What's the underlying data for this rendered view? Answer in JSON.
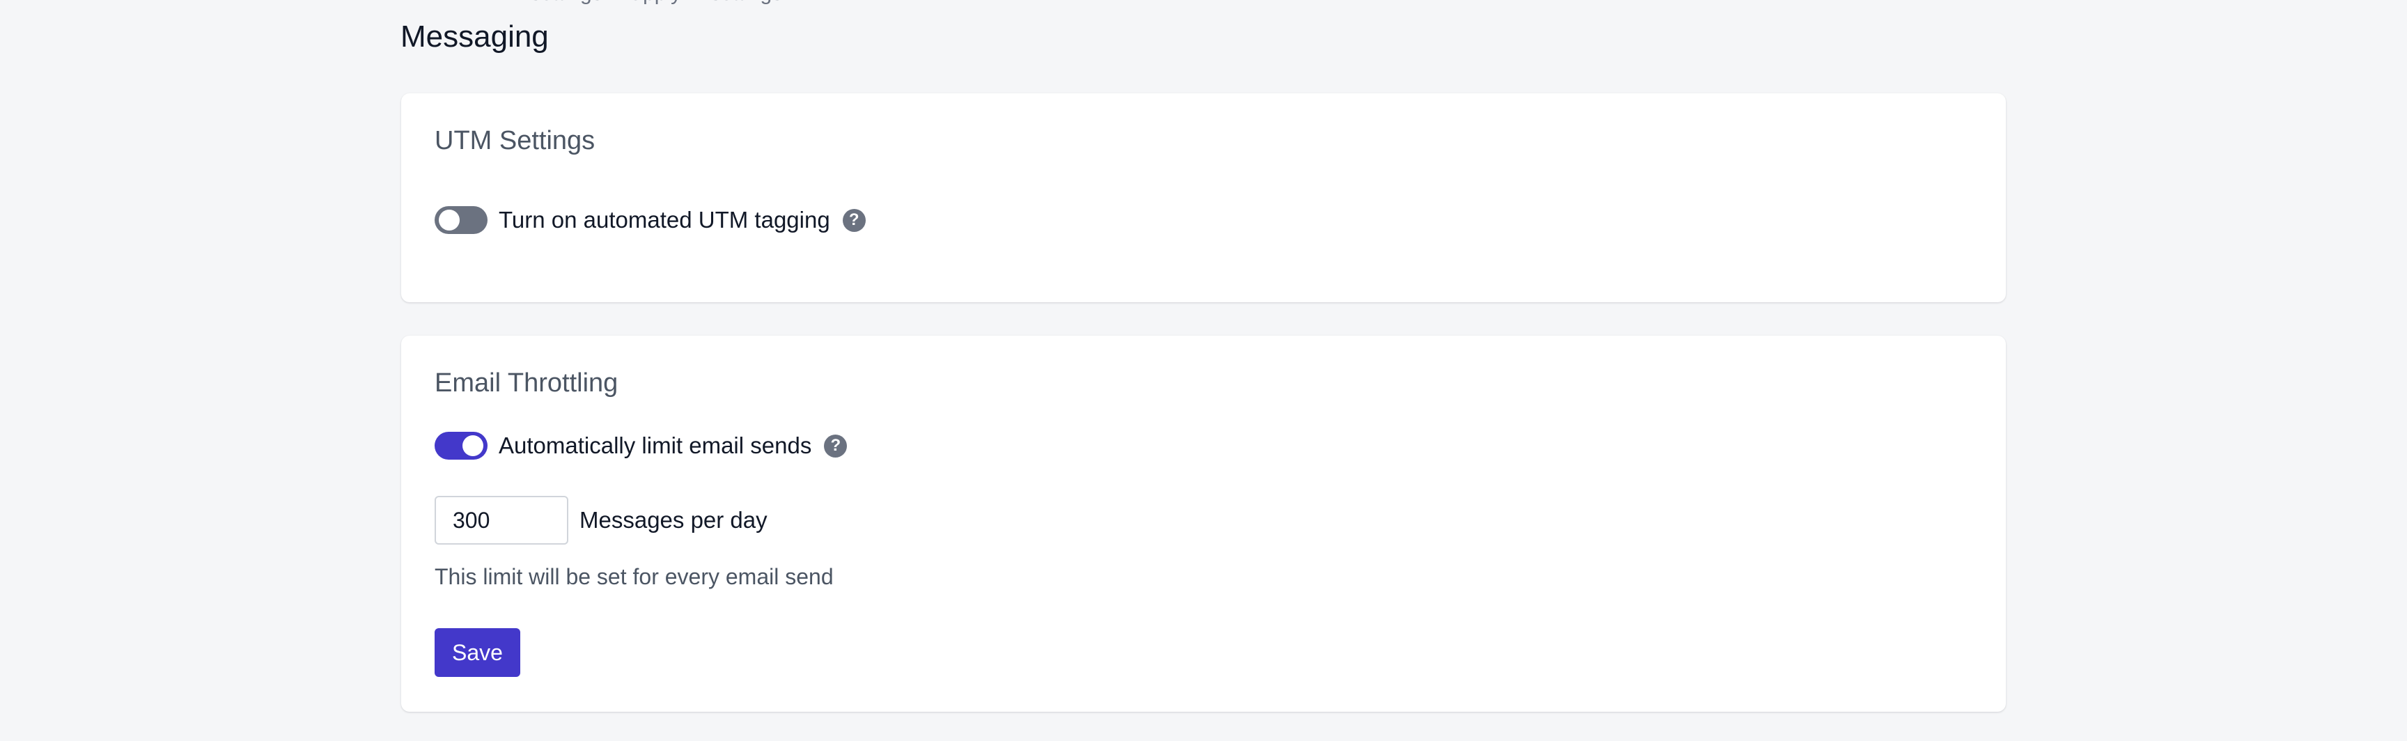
{
  "page": {
    "top_cut_text": "... settings ... apply ... settings",
    "title": "Messaging"
  },
  "utm_settings": {
    "title": "UTM Settings",
    "toggle_label": "Turn on automated UTM tagging",
    "toggle_on": false,
    "help_icon": "question-circle-icon"
  },
  "email_throttling": {
    "title": "Email Throttling",
    "toggle_label": "Automatically limit email sends",
    "toggle_on": true,
    "help_icon": "question-circle-icon",
    "limit_value": "300",
    "limit_unit": "Messages per day",
    "hint": "This limit will be set for every email send",
    "save_label": "Save"
  },
  "colors": {
    "accent": "#4338ca",
    "toggle_off": "#6b7280",
    "background": "#f5f6f8"
  }
}
